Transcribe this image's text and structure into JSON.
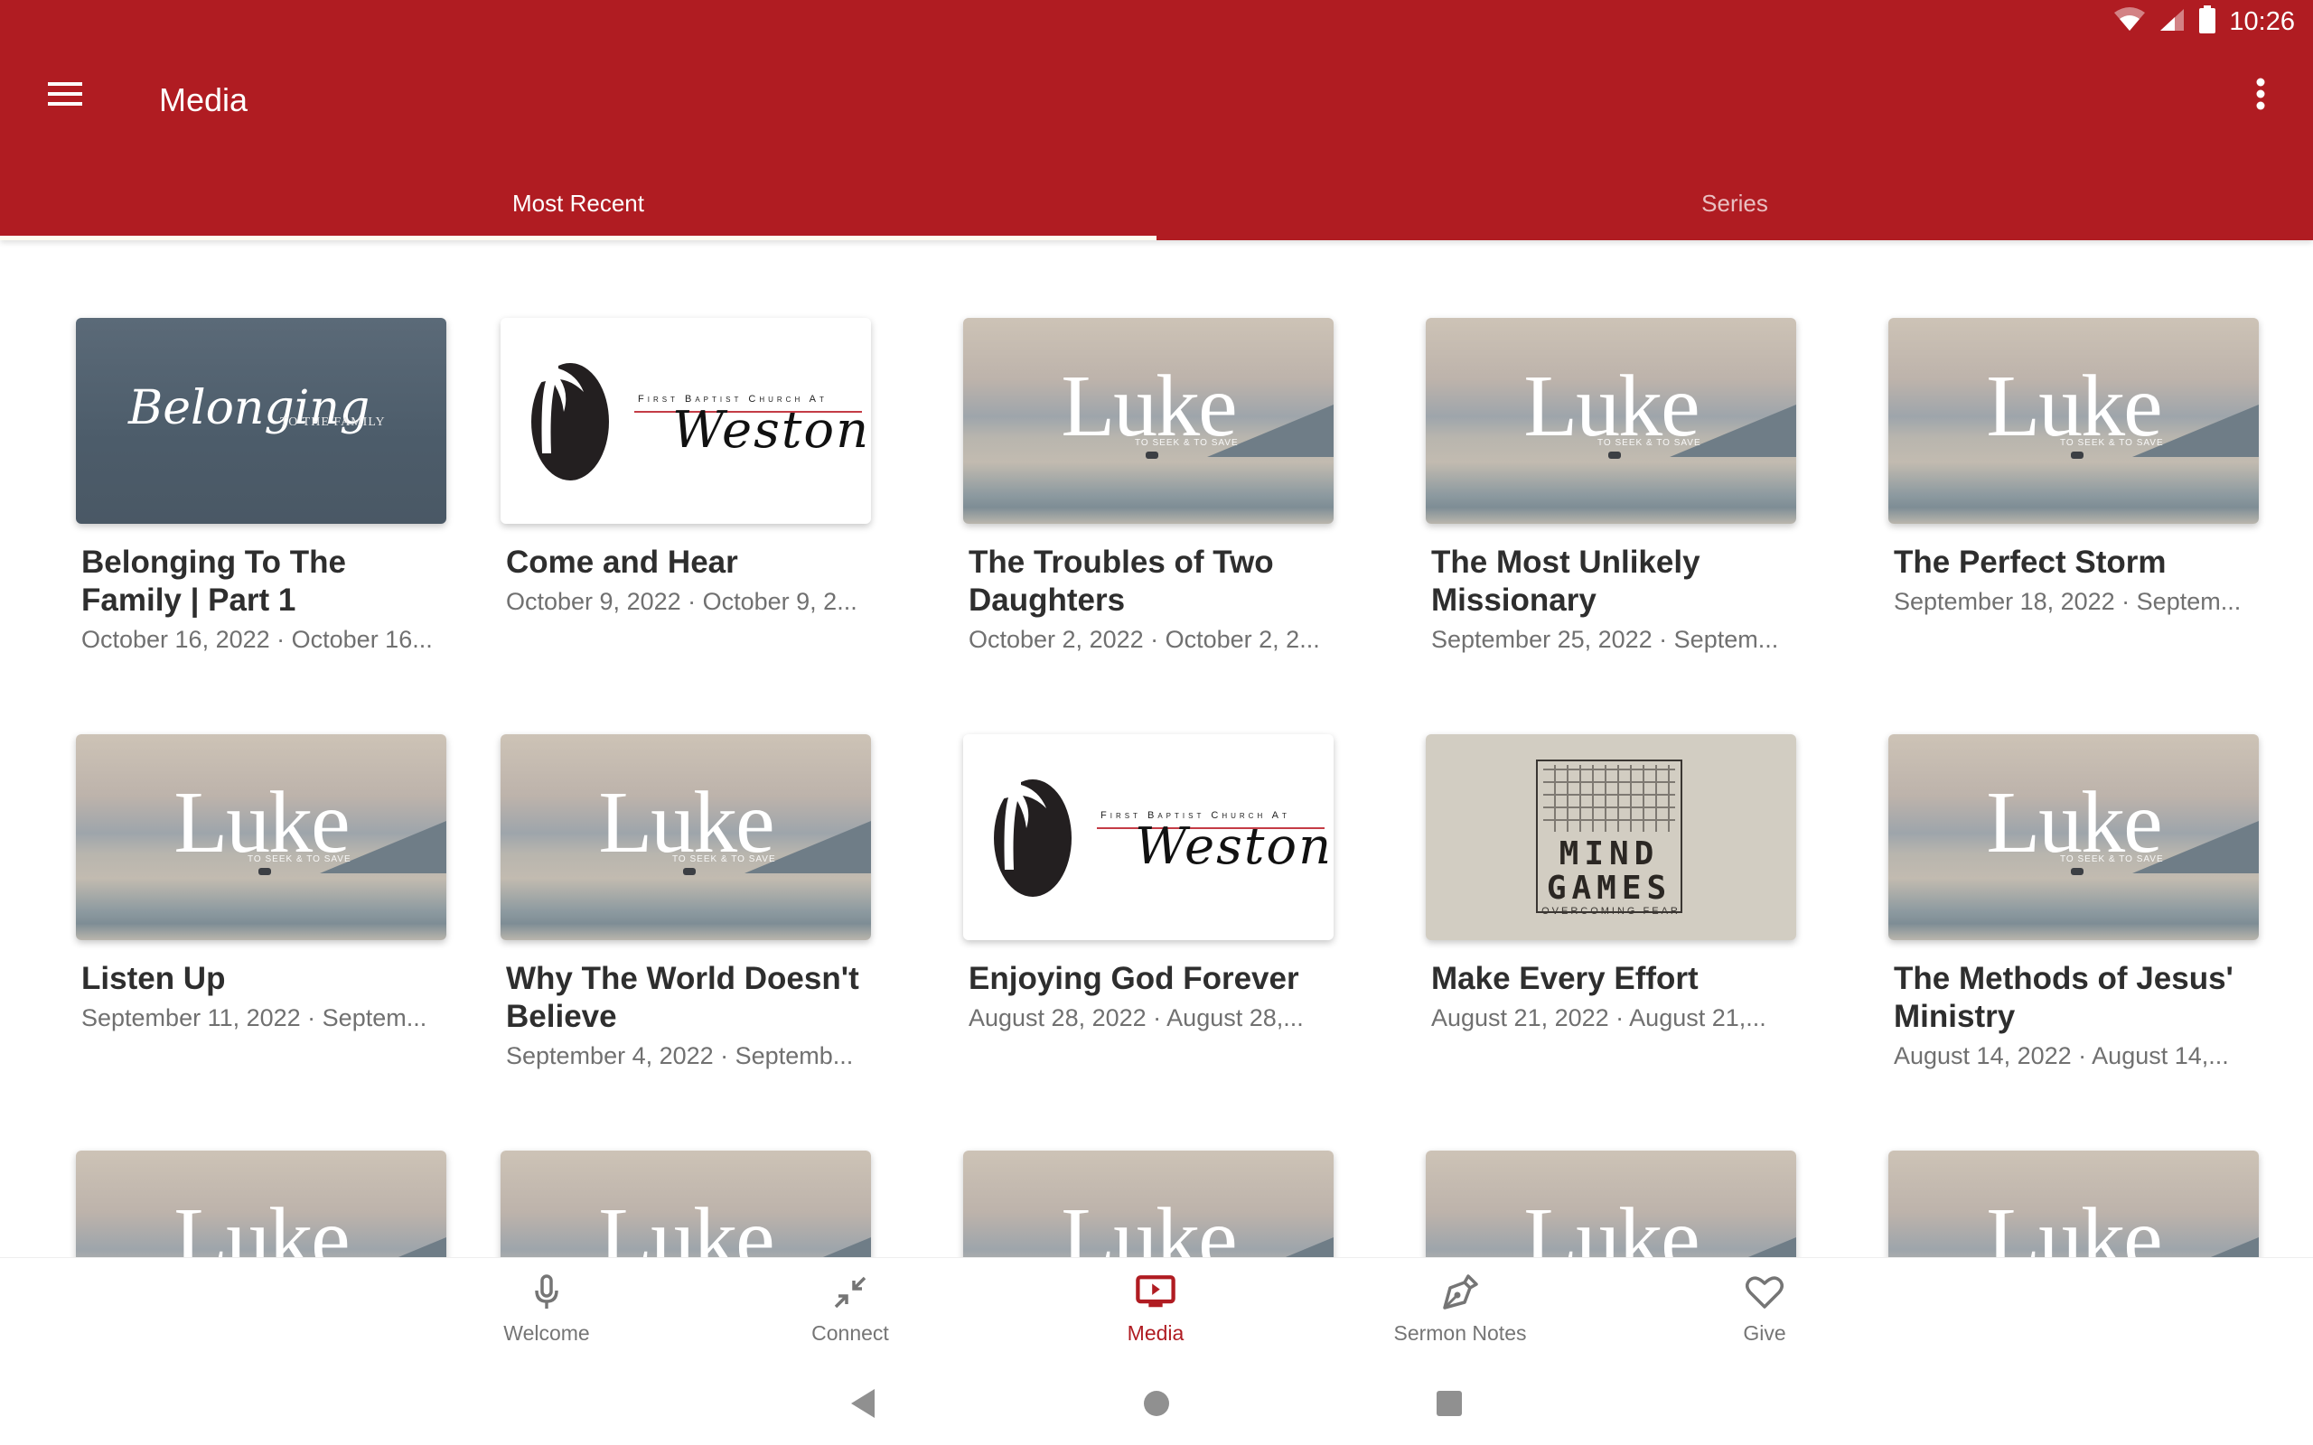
{
  "status_bar": {
    "time": "10:26",
    "icons": [
      "wifi-icon",
      "cell-signal-icon",
      "battery-icon"
    ]
  },
  "toolbar": {
    "menu_icon": "hamburger-menu-icon",
    "title": "Media",
    "overflow_icon": "more-vert-icon"
  },
  "tabs": [
    {
      "label": "Most Recent",
      "active": true
    },
    {
      "label": "Series",
      "active": false
    }
  ],
  "colors": {
    "brand": "#b01c22",
    "nav_inactive": "#757575",
    "title_text": "#2e2e2e",
    "subtitle_text": "#707070"
  },
  "media_items": [
    {
      "title": "Belonging To The Family | Part 1",
      "subtitle": "October 16, 2022 · October 16...",
      "thumbnail": "belonging",
      "thumb_text": "Belonging",
      "thumb_subtext": "TO THE FAMILY"
    },
    {
      "title": "Come and Hear",
      "subtitle": "October 9, 2022 · October 9, 2...",
      "thumbnail": "weston",
      "thumb_text": "Weston",
      "thumb_subtext": "First Baptist Church At"
    },
    {
      "title": "The Troubles of Two Daughters",
      "subtitle": "October 2, 2022 · October 2, 2...",
      "thumbnail": "luke",
      "thumb_text": "Luke",
      "thumb_subtext": "TO SEEK & TO SAVE"
    },
    {
      "title": "The Most Unlikely Missionary",
      "subtitle": "September 25, 2022 · Septem...",
      "thumbnail": "luke",
      "thumb_text": "Luke",
      "thumb_subtext": "TO SEEK & TO SAVE"
    },
    {
      "title": "The Perfect Storm",
      "subtitle": "September 18, 2022 · Septem...",
      "thumbnail": "luke",
      "thumb_text": "Luke",
      "thumb_subtext": "TO SEEK & TO SAVE"
    },
    {
      "title": "Listen Up",
      "subtitle": "September 11, 2022 · Septem...",
      "thumbnail": "luke",
      "thumb_text": "Luke",
      "thumb_subtext": "TO SEEK & TO SAVE"
    },
    {
      "title": "Why The World Doesn't Believe",
      "subtitle": "September 4, 2022 · Septemb...",
      "thumbnail": "luke",
      "thumb_text": "Luke",
      "thumb_subtext": "TO SEEK & TO SAVE"
    },
    {
      "title": "Enjoying God Forever",
      "subtitle": "August 28, 2022 · August 28,...",
      "thumbnail": "weston",
      "thumb_text": "Weston",
      "thumb_subtext": "First Baptist Church At"
    },
    {
      "title": "Make Every Effort",
      "subtitle": "August 21, 2022 · August 21,...",
      "thumbnail": "mindgames",
      "thumb_text": "MIND GAMES",
      "thumb_subtext": "OVERCOMING FEAR"
    },
    {
      "title": "The Methods of Jesus' Ministry",
      "subtitle": "August 14, 2022 · August 14,...",
      "thumbnail": "luke",
      "thumb_text": "Luke",
      "thumb_subtext": "TO SEEK & TO SAVE"
    },
    {
      "title": "",
      "subtitle": "",
      "thumbnail": "luke",
      "thumb_text": "Luke",
      "thumb_subtext": ""
    },
    {
      "title": "",
      "subtitle": "",
      "thumbnail": "luke",
      "thumb_text": "Luke",
      "thumb_subtext": ""
    },
    {
      "title": "",
      "subtitle": "",
      "thumbnail": "luke",
      "thumb_text": "Luke",
      "thumb_subtext": ""
    },
    {
      "title": "",
      "subtitle": "",
      "thumbnail": "luke",
      "thumb_text": "Luke",
      "thumb_subtext": ""
    },
    {
      "title": "",
      "subtitle": "",
      "thumbnail": "luke",
      "thumb_text": "Luke",
      "thumb_subtext": ""
    }
  ],
  "bottom_nav": [
    {
      "label": "Welcome",
      "icon": "microphone-icon",
      "active": false
    },
    {
      "label": "Connect",
      "icon": "connect-arrows-icon",
      "active": false
    },
    {
      "label": "Media",
      "icon": "media-tv-play-icon",
      "active": true
    },
    {
      "label": "Sermon Notes",
      "icon": "pen-nib-icon",
      "active": false
    },
    {
      "label": "Give",
      "icon": "heart-icon",
      "active": false
    }
  ],
  "system_nav": [
    "back-icon",
    "home-icon",
    "recents-icon"
  ]
}
